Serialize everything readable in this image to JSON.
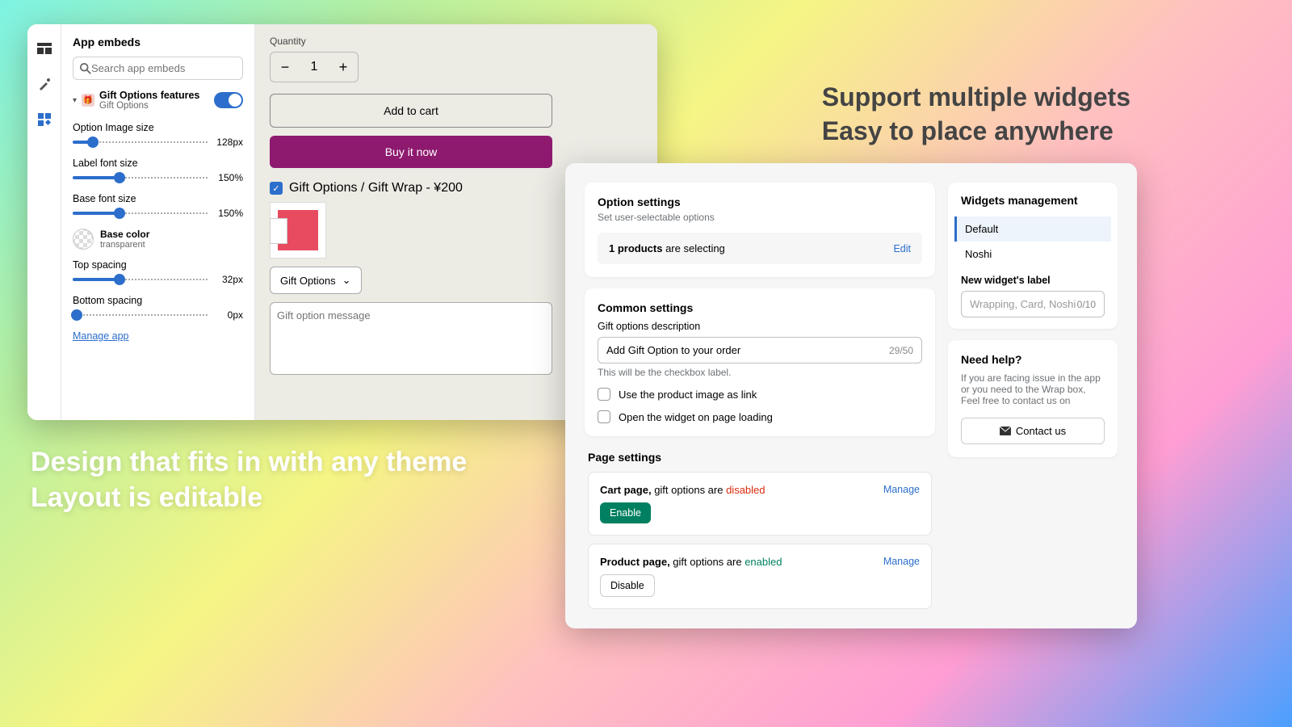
{
  "left": {
    "title": "App embeds",
    "searchPlaceholder": "Search app embeds",
    "feature": {
      "title": "Gift Options features",
      "sub": "Gift Options"
    },
    "sliders": [
      {
        "label": "Option Image size",
        "value": "128px",
        "pct": 15
      },
      {
        "label": "Label font size",
        "value": "150%",
        "pct": 35
      },
      {
        "label": "Base font size",
        "value": "150%",
        "pct": 35
      },
      {
        "label": "Top spacing",
        "value": "32px",
        "pct": 35
      },
      {
        "label": "Bottom spacing",
        "value": "0px",
        "pct": 3
      }
    ],
    "color": {
      "title": "Base color",
      "sub": "transparent"
    },
    "manage": "Manage app"
  },
  "preview": {
    "qtyLabel": "Quantity",
    "qty": "1",
    "addCart": "Add to cart",
    "buyNow": "Buy it now",
    "checkLabel": "Gift Options / Gift Wrap - ¥200",
    "selectLabel": "Gift Options",
    "msgPlaceholder": "Gift option message"
  },
  "captionLeft1": "Design that fits in with any theme",
  "captionLeft2": "Layout is editable",
  "captionRight1": "Support multiple widgets",
  "captionRight2": "Easy to place anywhere",
  "right": {
    "option": {
      "title": "Option settings",
      "sub": "Set user-selectable options",
      "productsBold": "1 products",
      "productsRest": " are selecting",
      "edit": "Edit"
    },
    "common": {
      "title": "Common settings",
      "descLabel": "Gift options description",
      "descValue": "Add Gift Option to your order",
      "descCount": "29/50",
      "descHelp": "This will be the checkbox label.",
      "chk1": "Use the product image as link",
      "chk2": "Open the widget on page loading"
    },
    "page": {
      "title": "Page settings",
      "cartBold": "Cart page,",
      "cartRest": " gift options are ",
      "cartState": "disabled",
      "enable": "Enable",
      "prodBold": "Product page,",
      "prodRest": " gift options are ",
      "prodState": "enabled",
      "disable": "Disable",
      "manage": "Manage"
    },
    "widgets": {
      "title": "Widgets management",
      "items": [
        "Default",
        "Noshi"
      ],
      "newLabel": "New widget's label",
      "placeholder": "Wrapping, Card, Noshi",
      "count": "0/10"
    },
    "help": {
      "title": "Need help?",
      "text": "If you are facing issue in the app or you need to the Wrap box, Feel free to contact us on",
      "btn": "Contact us"
    }
  }
}
